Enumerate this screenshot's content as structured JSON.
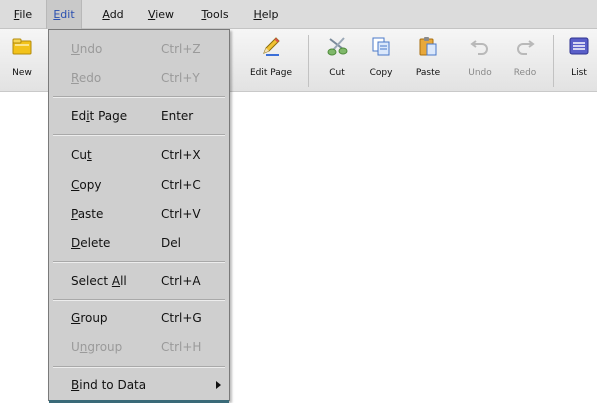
{
  "menubar": {
    "items": [
      {
        "label": "File",
        "mnemonic": "F",
        "rest": "ile"
      },
      {
        "label": "Edit",
        "mnemonic": "E",
        "rest": "dit"
      },
      {
        "label": "Add",
        "mnemonic": "A",
        "rest": "dd"
      },
      {
        "label": "View",
        "mnemonic": "V",
        "rest": "iew"
      },
      {
        "label": "Tools",
        "mnemonic": "T",
        "rest": "ools"
      },
      {
        "label": "Help",
        "mnemonic": "H",
        "rest": "elp"
      }
    ]
  },
  "toolbar": {
    "buttons": [
      {
        "label": "New",
        "icon": "new-folder-icon",
        "enabled": true
      },
      {
        "label": "Edit Page",
        "icon": "pencil-icon",
        "enabled": true
      },
      {
        "label": "Cut",
        "icon": "scissors-icon",
        "enabled": true
      },
      {
        "label": "Copy",
        "icon": "copy-icon",
        "enabled": true
      },
      {
        "label": "Paste",
        "icon": "paste-icon",
        "enabled": true
      },
      {
        "label": "Undo",
        "icon": "undo-icon",
        "enabled": false
      },
      {
        "label": "Redo",
        "icon": "redo-icon",
        "enabled": false
      },
      {
        "label": "List",
        "icon": "list-icon",
        "enabled": true
      }
    ]
  },
  "edit_menu": {
    "items": [
      {
        "pre": "",
        "mn": "U",
        "post": "ndo",
        "shortcut": "Ctrl+Z",
        "enabled": false
      },
      {
        "pre": "",
        "mn": "R",
        "post": "edo",
        "shortcut": "Ctrl+Y",
        "enabled": false
      },
      {
        "pre": "Ed",
        "mn": "i",
        "post": "t Page",
        "shortcut": "Enter",
        "enabled": true
      },
      {
        "pre": "Cu",
        "mn": "t",
        "post": "",
        "shortcut": "Ctrl+X",
        "enabled": true
      },
      {
        "pre": "",
        "mn": "C",
        "post": "opy",
        "shortcut": "Ctrl+C",
        "enabled": true
      },
      {
        "pre": "",
        "mn": "P",
        "post": "aste",
        "shortcut": "Ctrl+V",
        "enabled": true
      },
      {
        "pre": "",
        "mn": "D",
        "post": "elete",
        "shortcut": "Del",
        "enabled": true
      },
      {
        "pre": "Select ",
        "mn": "A",
        "post": "ll",
        "shortcut": "Ctrl+A",
        "enabled": true
      },
      {
        "pre": "",
        "mn": "G",
        "post": "roup",
        "shortcut": "Ctrl+G",
        "enabled": true
      },
      {
        "pre": "U",
        "mn": "n",
        "post": "group",
        "shortcut": "Ctrl+H",
        "enabled": false
      },
      {
        "pre": "",
        "mn": "B",
        "post": "ind to Data",
        "shortcut": "",
        "enabled": true
      }
    ]
  },
  "colors": {
    "menubar_bg": "#dcdcdc",
    "active_menu_text": "#2a4fb0",
    "dropdown_bg": "#cfcfcf",
    "disabled_text": "#9a9a9a"
  }
}
